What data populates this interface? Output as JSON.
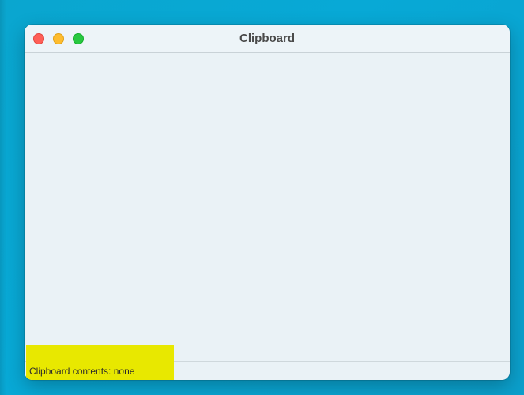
{
  "window": {
    "title": "Clipboard"
  },
  "traffic_lights": {
    "close_color": "#fe5f57",
    "minimize_color": "#febc2e",
    "zoom_color": "#28c840"
  },
  "status_bar": {
    "text": "Clipboard contents: none",
    "highlight_color": "#e8e800"
  },
  "icons": [
    "close-icon",
    "minimize-icon",
    "zoom-icon"
  ]
}
